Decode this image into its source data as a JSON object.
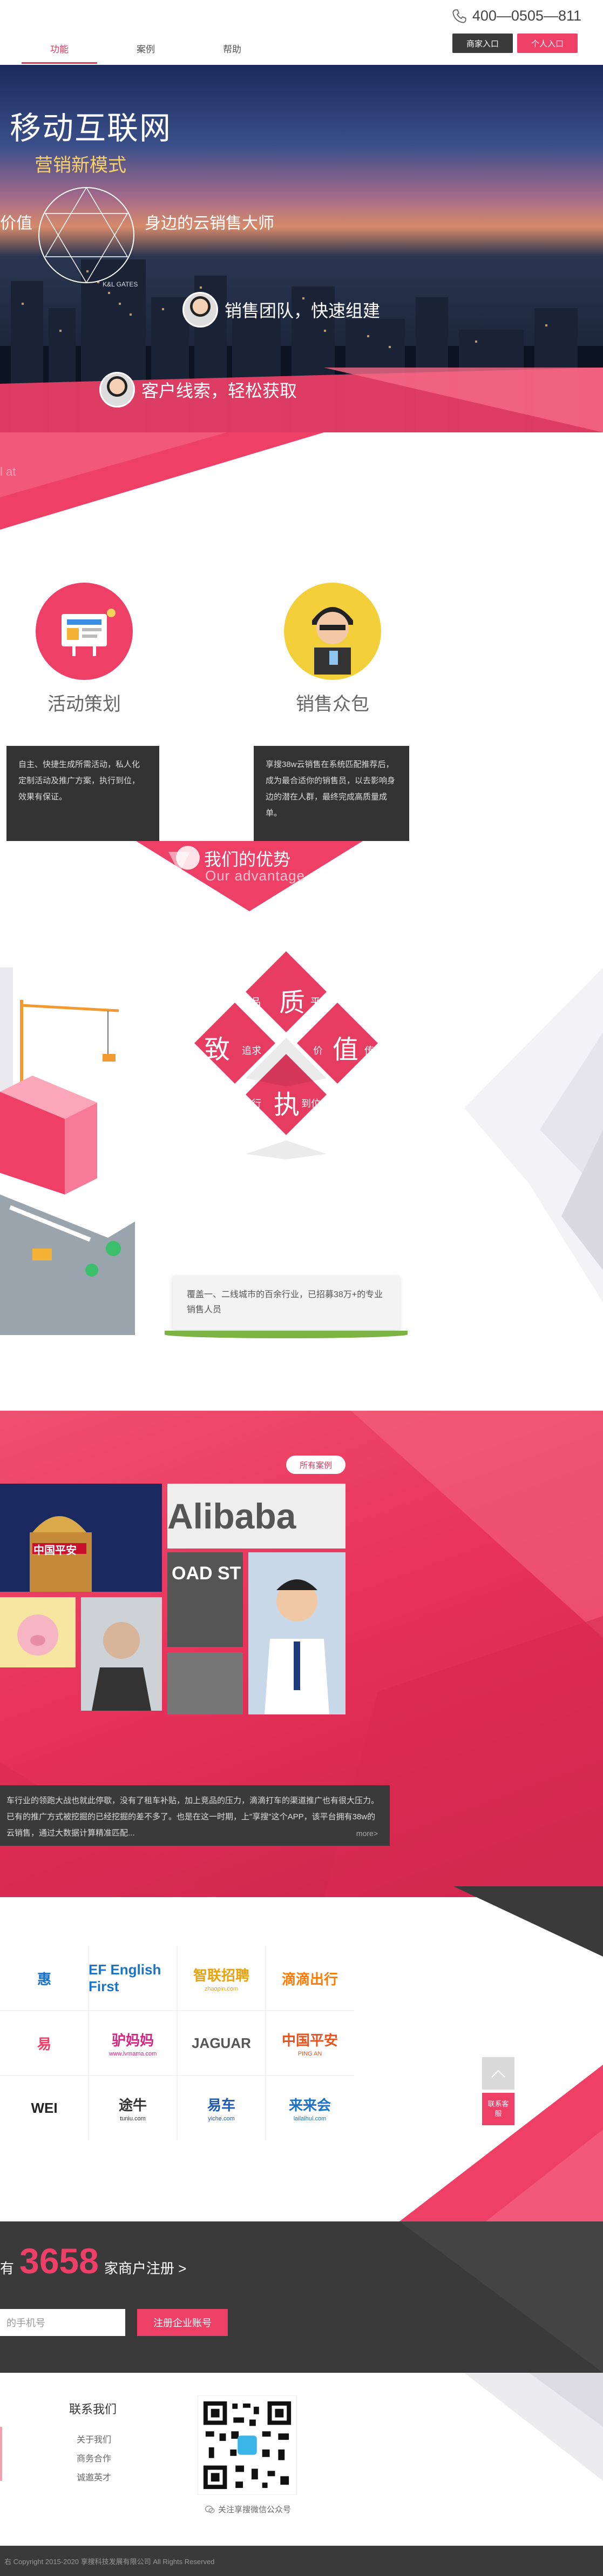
{
  "header": {
    "phone": "400—0505—811",
    "phone_icon": "phone-icon",
    "nav": [
      {
        "label": "功能",
        "active": true
      },
      {
        "label": "案例",
        "active": false
      },
      {
        "label": "帮助",
        "active": false
      }
    ],
    "merchant_btn": "商家入口",
    "personal_btn": "个人入口"
  },
  "hero": {
    "title": "移动互联网",
    "subtitle": "营销新模式",
    "line_left": "价值",
    "line_right": "身边的云销售大师",
    "badge1": "销售团队，快速组建",
    "badge2": "客户线索，轻松获取",
    "fragment": "l at"
  },
  "services": {
    "items": [
      {
        "label": "活动策划",
        "icon": "activity-board-icon",
        "desc": "自主、快捷生成所需活动，私人化定制活动及推广方案，执行到位，效果有保证。"
      },
      {
        "label": "销售众包",
        "icon": "salesman-avatar-icon",
        "desc": "享搜38w云销售在系统匹配推荐后，成为最合适你的销售员，以去影响身边的潜在人群，最终完成高质量成单。"
      }
    ],
    "advantage_title": "我们的优势",
    "advantage_sub": "Our advantage"
  },
  "advantages": {
    "d1_main": "质",
    "d1_left": "品",
    "d1_right": "平台",
    "d2_main": "致",
    "d2_left": "极",
    "d2_right": "追求",
    "d3_main": "值",
    "d3_left": "价",
    "d3_right": "传播",
    "d4_main": "执",
    "d4_left": "行",
    "d4_right": "到位",
    "coverage": "覆盖一、二线城市的百余行业，已招募38万+的专业销售人员"
  },
  "cases": {
    "all_cases": "所有案例",
    "tile1": "中国平安",
    "tile2": "Alibaba",
    "tile3": "OAD ST",
    "desc": "车行业的领跑大战也就此停歇，没有了租车补贴，加上竞品的压力，滴滴打车的渠道推广也有很大压力。已有的推广方式被挖掘的已经挖掘的差不多了。也是在这一时期，上\"享搜\"这个APP，该平台拥有38w的云销售，通过大数据计算精准匹配...",
    "more": "more>"
  },
  "partners": {
    "logos": [
      {
        "name": "惠",
        "sub": "",
        "color": "#1a73c8"
      },
      {
        "name": "EF English First",
        "sub": "",
        "color": "#1a73c8"
      },
      {
        "name": "智联招聘",
        "sub": "zhaopin.com",
        "color": "#e8a20c"
      },
      {
        "name": "滴滴出行",
        "sub": "",
        "color": "#ff7a00"
      },
      {
        "name": "易",
        "sub": "",
        "color": "#ee3f67"
      },
      {
        "name": "驴妈妈",
        "sub": "www.lvmama.com",
        "color": "#d6267f"
      },
      {
        "name": "JAGUAR",
        "sub": "",
        "color": "#555555"
      },
      {
        "name": "中国平安",
        "sub": "PING AN",
        "color": "#e8521e"
      },
      {
        "name": "WEI",
        "sub": "",
        "color": "#222222"
      },
      {
        "name": "途牛",
        "sub": "tuniu.com",
        "color": "#333333"
      },
      {
        "name": "易车",
        "sub": "yiche.com",
        "color": "#1a5bb8"
      },
      {
        "name": "来来会",
        "sub": "lailaihui.com",
        "color": "#1a73c8"
      }
    ],
    "top_icon": "arrow-up-icon",
    "contact_btn": "联系客服"
  },
  "register": {
    "prefix": "有",
    "count": "3658",
    "suffix": "家商户注册 >",
    "input_placeholder": "的手机号",
    "button": "注册企业账号"
  },
  "footer": {
    "contact_title": "联系我们",
    "links": [
      "关于我们",
      "商务合作",
      "诚邀英才"
    ],
    "qr_caption": "关注享搜微信公众号",
    "copyright": "右 Copyright 2015-2020 享搜科技发展有限公司 All Rights Reserved"
  },
  "colors": {
    "accent": "#e8325a",
    "dark": "#3a3a3a"
  }
}
